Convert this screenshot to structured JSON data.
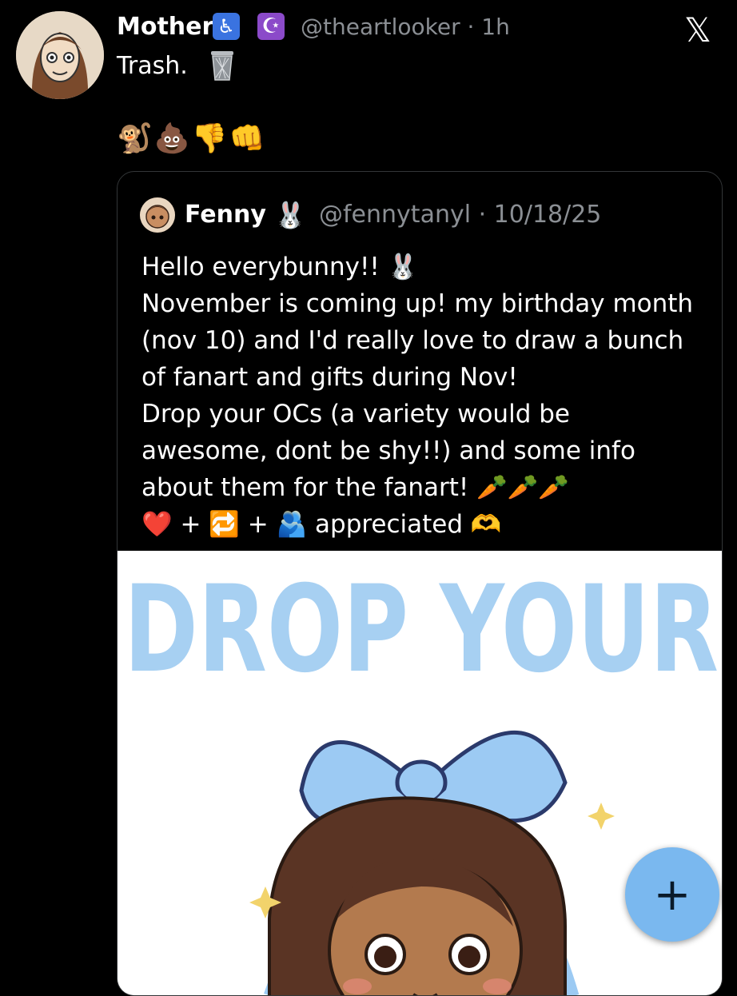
{
  "post": {
    "author_name": "Mother",
    "badge_accessibility": "♿",
    "badge_crescent": "☪",
    "handle_time": "@theartlooker · 1h",
    "text": "Trash.",
    "emojis": "🐒💩👎👊",
    "x_logo": "𝕏"
  },
  "quoted": {
    "author_name": "Fenny",
    "author_emoji": "🐰",
    "handle_date": "@fennytanyl · 10/18/25",
    "lines": [
      "Hello everybunny!! 🐰",
      "November is coming up! my birthday month",
      "(nov 10) and I'd really love to draw a bunch",
      "of fanart and gifts during Nov!",
      "Drop your OCs (a variety would be",
      "awesome, dont be shy!!) and some info",
      "about them for the fanart! 🥕🥕🥕",
      "❤️ + 🔁 + 🫂 appreciated 🫶"
    ],
    "image_text": "DROP YOUR"
  },
  "fab": {
    "label": "+"
  },
  "colors": {
    "accent": "#7ab8ef",
    "image_text": "#a7d0f2"
  }
}
